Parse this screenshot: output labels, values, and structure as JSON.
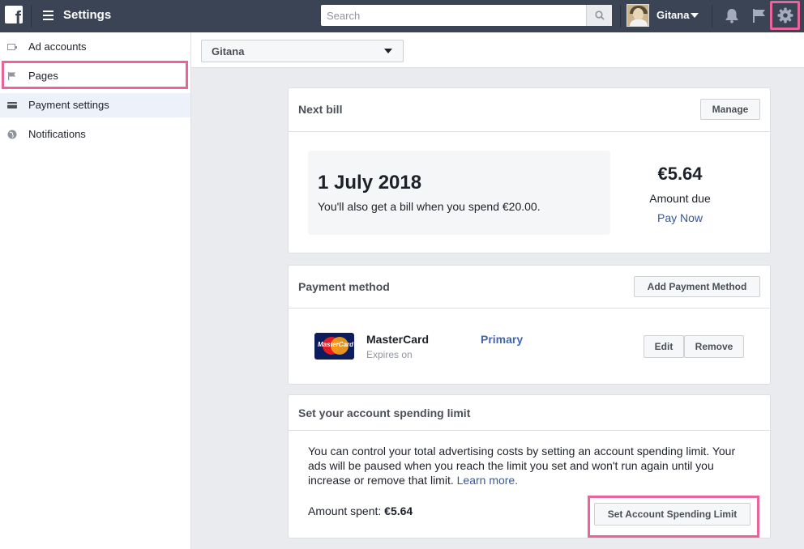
{
  "topbar": {
    "logo": "f",
    "title": "Settings",
    "search_placeholder": "Search",
    "user_name": "Gitana",
    "icons": [
      "menu-icon",
      "search-icon",
      "bell-icon",
      "flag-icon",
      "gear-icon"
    ]
  },
  "sidebar": {
    "items": [
      {
        "label": "Ad accounts",
        "icon": "ad-accounts-icon"
      },
      {
        "label": "Pages",
        "icon": "flag-icon"
      },
      {
        "label": "Payment settings",
        "icon": "credit-card-icon",
        "active": true
      },
      {
        "label": "Notifications",
        "icon": "globe-icon"
      }
    ]
  },
  "account_selector": {
    "value": "Gitana"
  },
  "next_bill": {
    "title": "Next bill",
    "manage_label": "Manage",
    "date": "1 July 2018",
    "subtext": "You'll also get a bill when you spend €20.00.",
    "amount": "€5.64",
    "amount_label": "Amount due",
    "pay_now_label": "Pay Now"
  },
  "payment_method": {
    "title": "Payment method",
    "add_label": "Add Payment Method",
    "card_logo_text": "MasterCard",
    "card_name": "MasterCard",
    "expires": "Expires on",
    "status": "Primary",
    "edit_label": "Edit",
    "remove_label": "Remove"
  },
  "spending_limit": {
    "title": "Set your account spending limit",
    "description": "You can control your total advertising costs by setting an account spending limit. Your ads will be paused when you reach the limit you set and won't run again until you increase or remove that limit.",
    "learn_more": "Learn more.",
    "amount_spent_label": "Amount spent:",
    "amount_spent_value": "€5.64",
    "button_label": "Set Account Spending Limit"
  },
  "colors": {
    "topbar": "#3b4455",
    "highlight": "#e8649b",
    "link": "#365899",
    "primary": "#4267b2"
  }
}
